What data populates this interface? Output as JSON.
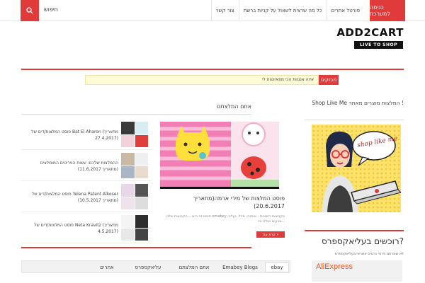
{
  "topbar": {
    "search_label": "חיפוש",
    "login_label": "כניסה למערכת",
    "nav": [
      "פורטל אתרים",
      "כל מה שרצית לשאול על קניות ברשת",
      "צור קשר"
    ]
  },
  "logo": {
    "main": "ADD2CART",
    "sub": "LIVE TO SHOP"
  },
  "ticker": {
    "tag": "מבזקים",
    "text": "איזה אנגזות הכי מפאיוטות לי"
  },
  "sections": {
    "recommenders": "אתם המלצתם",
    "sidebar_title": "Shop Like Me המלצות מוצרים מאתר !"
  },
  "featured": {
    "title": "פוסט המלצות של מירי ארמה(מתאריך 20.6.2017)",
    "excerpt": "פוסט זה הינו ...הקבוצות שלנו emabey בקבוצות הזמנות - אופנה, מכל, נעלב, צבעים ושלח וכו...",
    "read_more": "קרא עוד »"
  },
  "posts": [
    {
      "title": "פוסט המלצות/דים של Bat El Aharon (מתאריך 27.4.2017)"
    },
    {
      "title": "ההמלצות שלכם: עשות הפריטים המומלצים (מתאריך 11.6.2017)"
    },
    {
      "title": "פוסט המלצות/דים של Yelena Patent Alkoser (מתאריך 10.5.2017)"
    },
    {
      "title": "פוסט המלצות/דים של Neta Kravitz (מתאריך 4.5.2017)"
    }
  ],
  "tabs": [
    "ebay",
    "Emabey Blogs",
    "אתם המלצתם",
    "עליאקספרס",
    "אחרים"
  ],
  "sidebar": {
    "image_caption": "shop like me",
    "heading": "רוכשים בעליאקספרס?",
    "desc": "לא שמרתם פרטי כרטיס אשראי בעליאקספרס",
    "brand": "AliExpress"
  },
  "colors": {
    "accent": "#e03a3a",
    "ticker_bg": "#fffbd6"
  }
}
